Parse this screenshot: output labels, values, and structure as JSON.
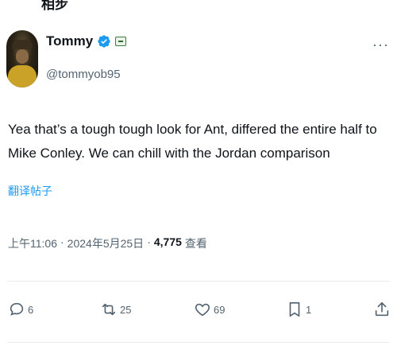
{
  "top_fragment": "相步",
  "author": {
    "display_name": "Tommy",
    "handle": "@tommyob95"
  },
  "icons": {
    "verified": "verified-badge-icon",
    "flag": "flag-icon",
    "more": "more-icon"
  },
  "post": {
    "text": "Yea that’s a tough tough look for Ant, differed the entire half to Mike Conley. We can chill with the Jordan comparison",
    "translate_label": "翻译帖子"
  },
  "meta": {
    "time": "上午11:06",
    "date": "2024年5月25日",
    "views_count": "4,775",
    "views_label": "查看"
  },
  "actions": {
    "reply_count": "6",
    "repost_count": "25",
    "like_count": "69",
    "bookmark_count": "1"
  },
  "colors": {
    "accent": "#1d9bf0",
    "muted": "#536471",
    "text": "#0f1419"
  }
}
